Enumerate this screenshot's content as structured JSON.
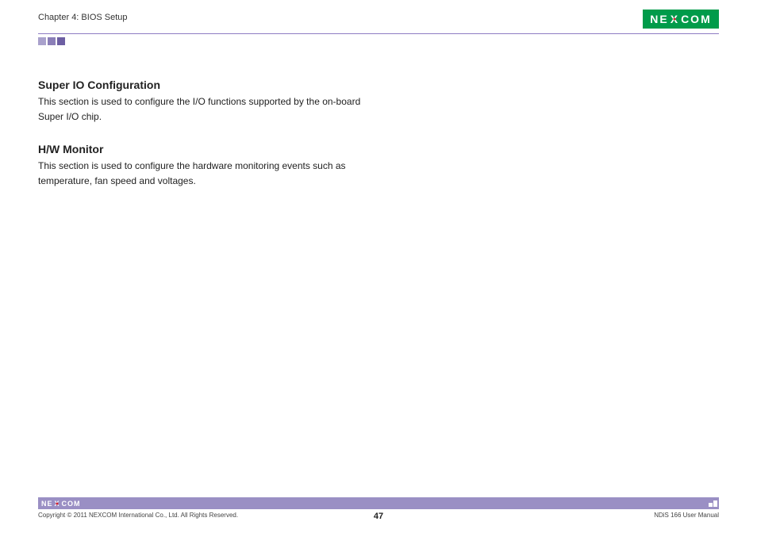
{
  "header": {
    "chapter": "Chapter 4: BIOS Setup",
    "logo_text_left": "NE",
    "logo_text_x": "X",
    "logo_text_right": "COM"
  },
  "sections": [
    {
      "heading": "Super IO Configuration",
      "body": "This section is used to configure the I/O functions supported by the on-board Super I/O chip."
    },
    {
      "heading": "H/W Monitor",
      "body": "This section is used to configure the hardware monitoring events such as temperature, fan speed and voltages."
    }
  ],
  "footer": {
    "logo_text": "NE COM",
    "copyright": "Copyright © 2011 NEXCOM International Co., Ltd. All Rights Reserved.",
    "page": "47",
    "docname": "NDiS 166 User Manual"
  }
}
